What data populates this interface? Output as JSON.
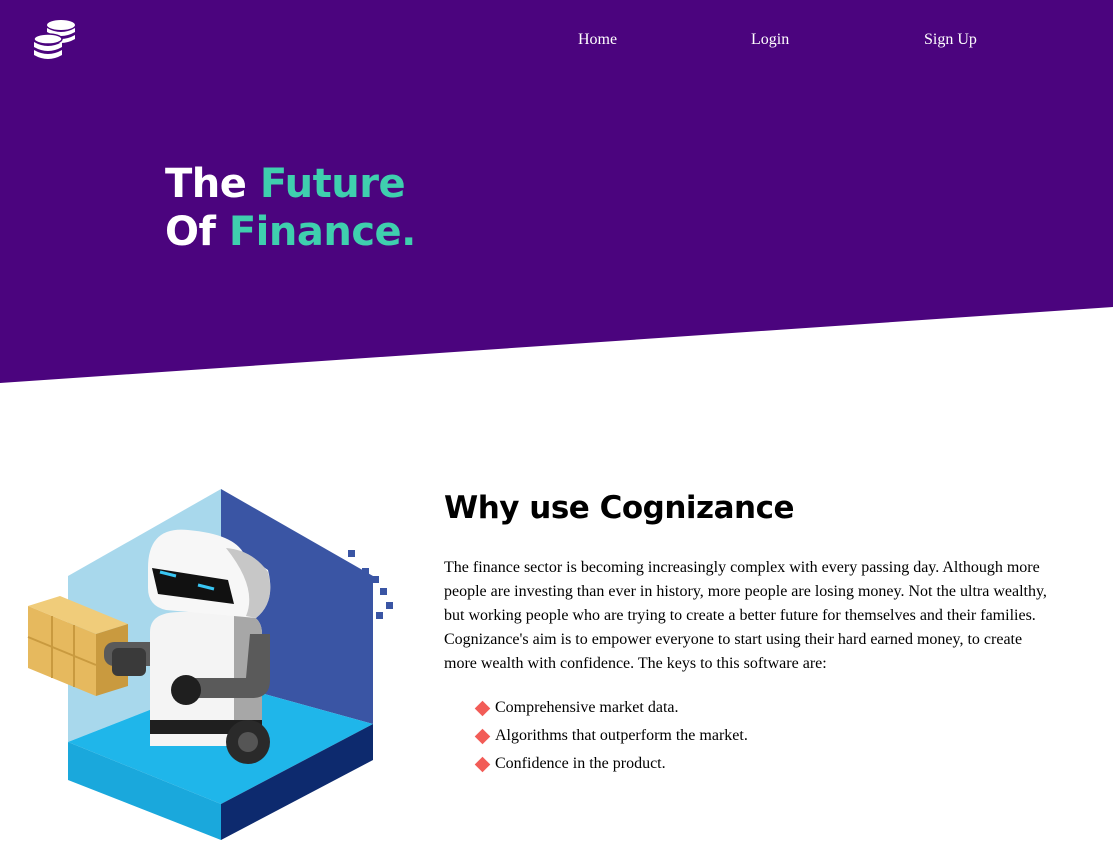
{
  "nav": {
    "home_label": "Home",
    "login_label": "Login",
    "signup_label": "Sign Up"
  },
  "hero": {
    "line1_plain": "The ",
    "line1_accent": "Future",
    "line2_plain": "Of ",
    "line2_accent": "Finance."
  },
  "why": {
    "title": "Why use Cognizance",
    "body": "The finance sector is becoming increasingly complex with every passing day. Although more people are investing than ever in history, more people are losing money. Not the ultra wealthy, but working people who are trying to create a better future for themselves and their families. Cognizance's aim is to empower everyone to start using their hard earned money, to create more wealth with confidence. The keys to this software are:",
    "keys": [
      "Comprehensive market data.",
      "Algorithms that outperform the market.",
      "Confidence in the product."
    ]
  },
  "colors": {
    "hero_purple": "#4b047e",
    "accent_teal": "#3fcfae",
    "bullet_red": "#f25c57"
  },
  "icons": {
    "logo": "coin-stack-icon",
    "bullet": "diamond-bullet-icon"
  }
}
